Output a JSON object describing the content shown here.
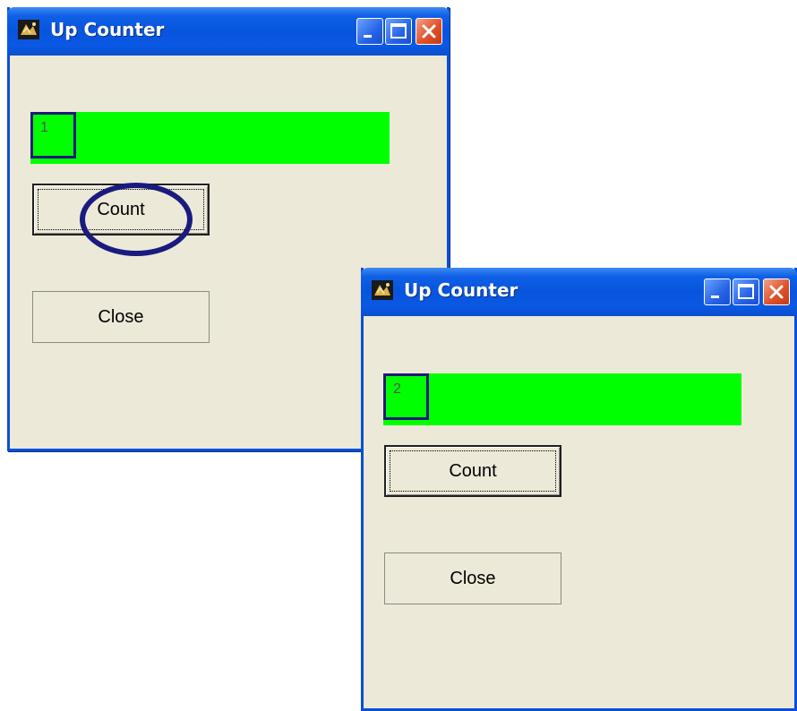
{
  "windows": [
    {
      "title": "Up Counter",
      "counter_value": "1",
      "count_label": "Count",
      "close_label": "Close"
    },
    {
      "title": "Up Counter",
      "counter_value": "2",
      "count_label": "Count",
      "close_label": "Close"
    }
  ],
  "colors": {
    "counter_fill": "#00ff00",
    "highlight": "#1b1a7f",
    "titlebar": "#0854dd",
    "window_face": "#ece9d8"
  },
  "icons": [
    "app-icon",
    "minimize-icon",
    "maximize-icon",
    "close-icon"
  ]
}
